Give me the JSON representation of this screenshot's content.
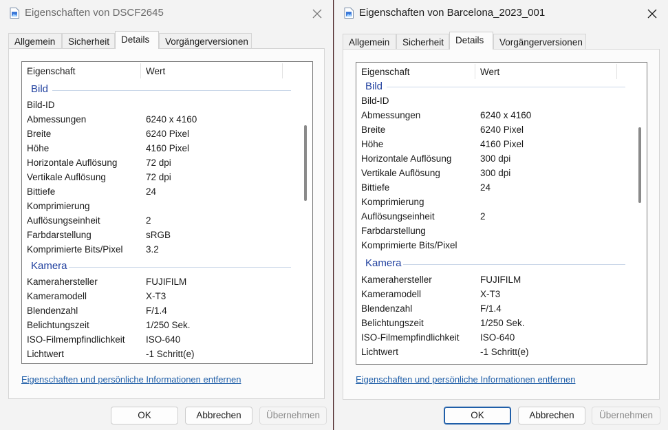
{
  "left": {
    "title": "Eigenschaften von DSCF2645",
    "tabs": [
      "Allgemein",
      "Sicherheit",
      "Details",
      "Vorgängerversionen"
    ],
    "columns": {
      "property": "Eigenschaft",
      "value": "Wert"
    },
    "groups": [
      {
        "title": "Bild",
        "rows": [
          {
            "name": "Bild-ID",
            "value": ""
          },
          {
            "name": "Abmessungen",
            "value": "6240 x 4160"
          },
          {
            "name": "Breite",
            "value": "6240 Pixel"
          },
          {
            "name": "Höhe",
            "value": "4160 Pixel"
          },
          {
            "name": "Horizontale Auflösung",
            "value": "72 dpi"
          },
          {
            "name": "Vertikale Auflösung",
            "value": "72 dpi"
          },
          {
            "name": "Bittiefe",
            "value": "24"
          },
          {
            "name": "Komprimierung",
            "value": ""
          },
          {
            "name": "Auflösungseinheit",
            "value": "2"
          },
          {
            "name": "Farbdarstellung",
            "value": "sRGB"
          },
          {
            "name": "Komprimierte Bits/Pixel",
            "value": "3.2"
          }
        ]
      },
      {
        "title": "Kamera",
        "rows": [
          {
            "name": "Kamerahersteller",
            "value": "FUJIFILM"
          },
          {
            "name": "Kameramodell",
            "value": "X-T3"
          },
          {
            "name": "Blendenzahl",
            "value": "F/1.4"
          },
          {
            "name": "Belichtungszeit",
            "value": "1/250 Sek."
          },
          {
            "name": "ISO-Filmempfindlichkeit",
            "value": "ISO-640"
          },
          {
            "name": "Lichtwert",
            "value": "-1 Schritt(e)"
          }
        ]
      }
    ],
    "link": "Eigenschaften und persönliche Informationen entfernen",
    "buttons": {
      "ok": "OK",
      "cancel": "Abbrechen",
      "apply": "Übernehmen"
    }
  },
  "right": {
    "title": "Eigenschaften von Barcelona_2023_001",
    "tabs": [
      "Allgemein",
      "Sicherheit",
      "Details",
      "Vorgängerversionen"
    ],
    "columns": {
      "property": "Eigenschaft",
      "value": "Wert"
    },
    "groups": [
      {
        "title": "Bild",
        "rows": [
          {
            "name": "Bild-ID",
            "value": ""
          },
          {
            "name": "Abmessungen",
            "value": "6240 x 4160"
          },
          {
            "name": "Breite",
            "value": "6240 Pixel"
          },
          {
            "name": "Höhe",
            "value": "4160 Pixel"
          },
          {
            "name": "Horizontale Auflösung",
            "value": "300 dpi"
          },
          {
            "name": "Vertikale Auflösung",
            "value": "300 dpi"
          },
          {
            "name": "Bittiefe",
            "value": "24"
          },
          {
            "name": "Komprimierung",
            "value": ""
          },
          {
            "name": "Auflösungseinheit",
            "value": "2"
          },
          {
            "name": "Farbdarstellung",
            "value": ""
          },
          {
            "name": "Komprimierte Bits/Pixel",
            "value": ""
          }
        ]
      },
      {
        "title": "Kamera",
        "rows": [
          {
            "name": "Kamerahersteller",
            "value": "FUJIFILM"
          },
          {
            "name": "Kameramodell",
            "value": "X-T3"
          },
          {
            "name": "Blendenzahl",
            "value": "F/1.4"
          },
          {
            "name": "Belichtungszeit",
            "value": "1/250 Sek."
          },
          {
            "name": "ISO-Filmempfindlichkeit",
            "value": "ISO-640"
          },
          {
            "name": "Lichtwert",
            "value": "-1 Schritt(e)"
          }
        ]
      }
    ],
    "link": "Eigenschaften und persönliche Informationen entfernen",
    "buttons": {
      "ok": "OK",
      "cancel": "Abbrechen",
      "apply": "Übernehmen"
    }
  },
  "icons": {
    "title": "image-file-icon",
    "close": "close-icon"
  },
  "colors": {
    "group_title": "#1f3f9e",
    "link": "#1f5ea8",
    "ok_focus": "#1f5ea8"
  }
}
